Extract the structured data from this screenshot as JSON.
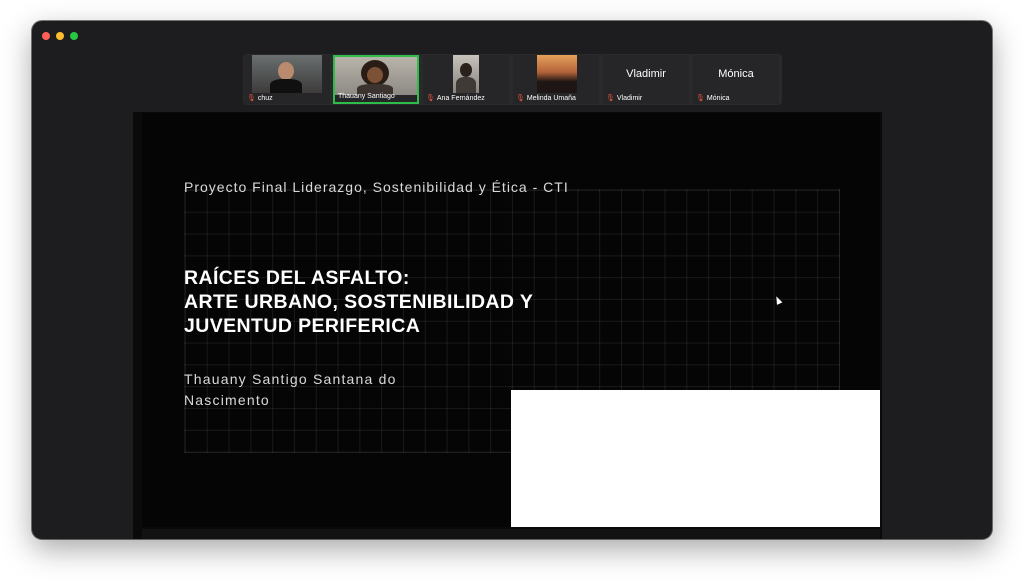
{
  "window": {
    "controls": [
      "close",
      "minimize",
      "zoom"
    ]
  },
  "participants": [
    {
      "name": "chuz",
      "muted": true,
      "has_video": true
    },
    {
      "name": "Thauany Santiago",
      "muted": false,
      "has_video": true,
      "active_speaker": true
    },
    {
      "name": "Ana Fernández",
      "muted": true,
      "has_video": true
    },
    {
      "name": "Melinda Umaña",
      "muted": true,
      "has_video": true
    },
    {
      "name": "Vladimir",
      "display_label": "Vladimir",
      "muted": true,
      "has_video": false
    },
    {
      "name": "Mónica",
      "display_label": "Mónica",
      "muted": true,
      "has_video": false
    }
  ],
  "slide": {
    "subtitle": "Proyecto Final Liderazgo, Sostenibilidad y Ética - CTI",
    "title_lines": [
      "RAÍCES DEL ASFALTO:",
      "ARTE URBANO, SOSTENIBILIDAD Y",
      "JUVENTUD PERIFERICA"
    ],
    "author_lines": [
      "Thauany Santigo Santana do",
      "Nascimento"
    ]
  },
  "colors": {
    "active_speaker_border": "#2fbd4a",
    "muted_icon": "#e5533d",
    "window_bg": "#1d1d1f",
    "slide_bg": "#050505"
  },
  "icons": {
    "mic_muted": "muted-mic-icon",
    "cursor": "mouse-cursor-icon"
  }
}
